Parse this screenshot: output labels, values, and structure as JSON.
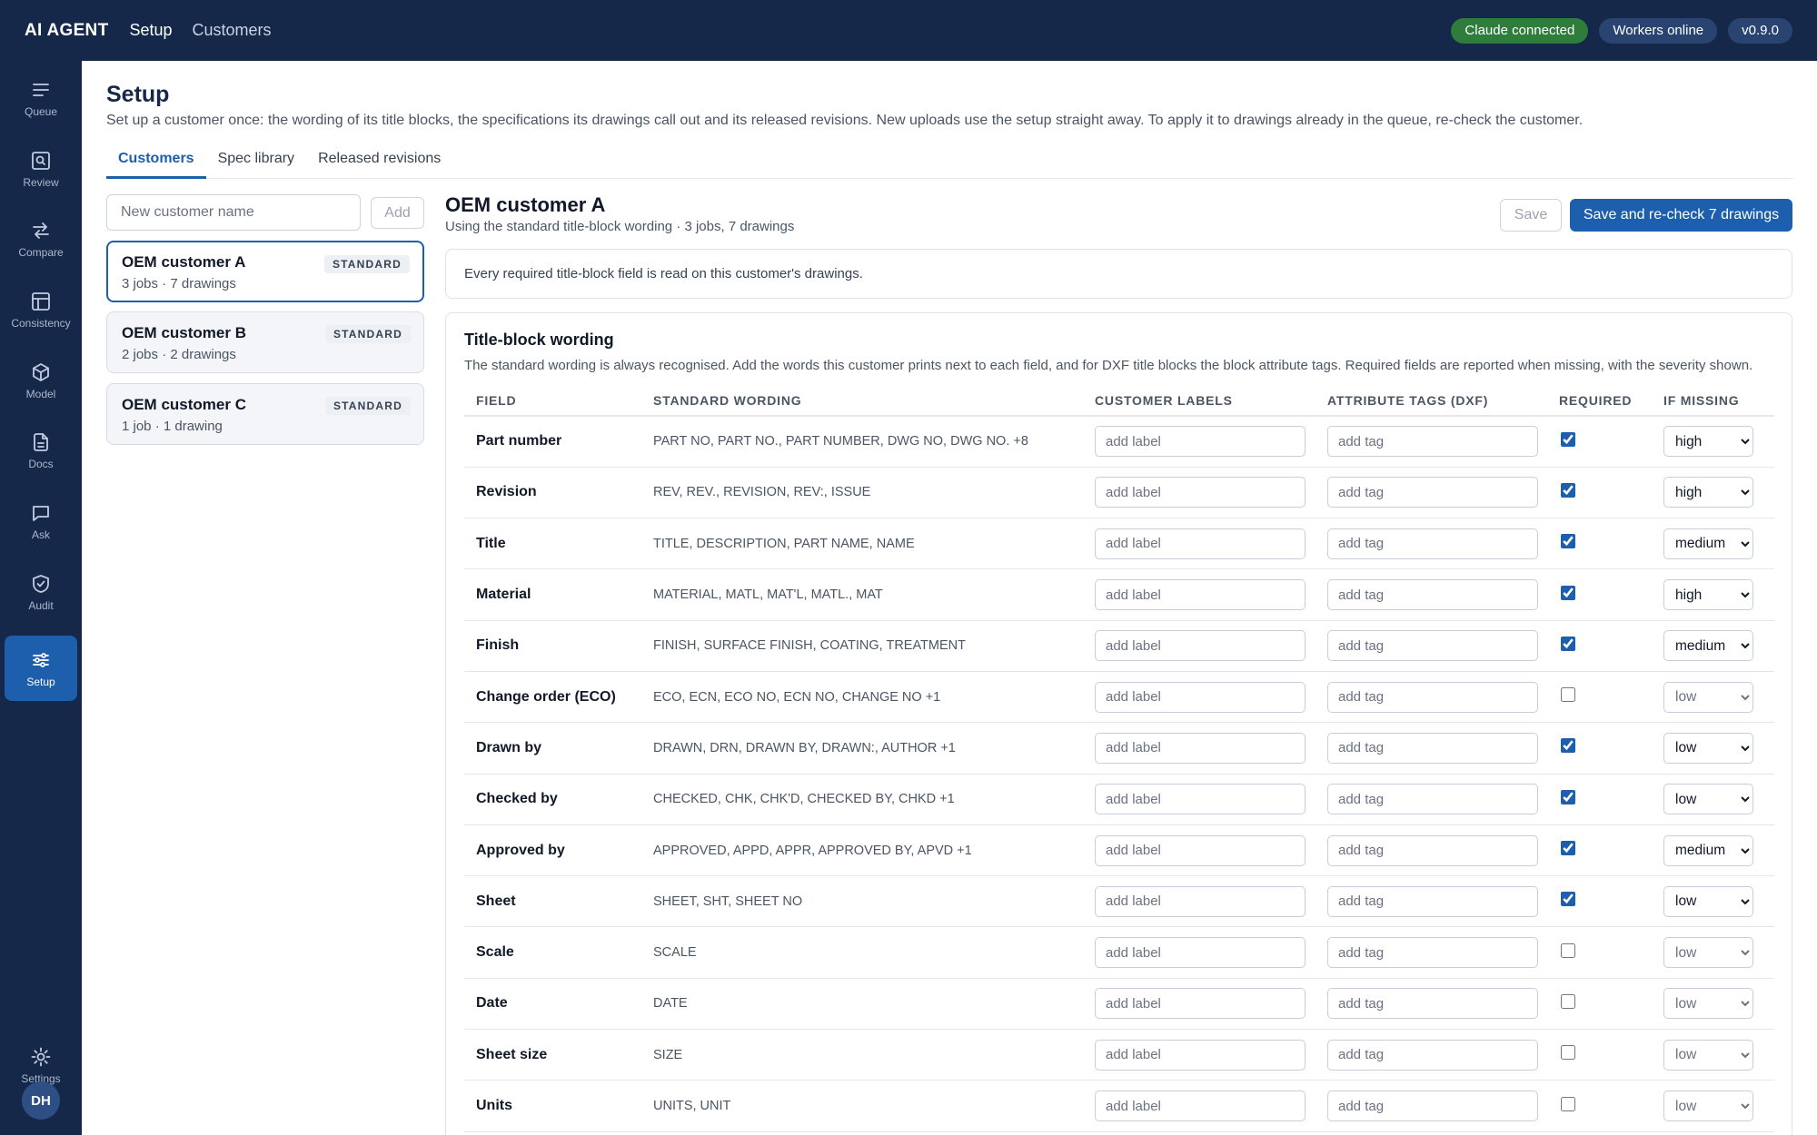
{
  "topbar": {
    "brand": "AI AGENT",
    "nav": [
      "Setup",
      "Customers"
    ],
    "status": [
      "Claude connected",
      "Workers online",
      "v0.9.0"
    ]
  },
  "sidebar": {
    "items": [
      {
        "label": "Queue",
        "icon": "queue-icon"
      },
      {
        "label": "Review",
        "icon": "review-icon"
      },
      {
        "label": "Compare",
        "icon": "compare-icon"
      },
      {
        "label": "Consistency",
        "icon": "consistency-icon"
      },
      {
        "label": "Model",
        "icon": "model-icon"
      },
      {
        "label": "Docs",
        "icon": "docs-icon"
      },
      {
        "label": "Ask",
        "icon": "ask-icon"
      },
      {
        "label": "Audit",
        "icon": "audit-icon"
      },
      {
        "label": "Setup",
        "icon": "setup-icon",
        "active": true
      }
    ],
    "settings_label": "Settings",
    "avatar": "DH"
  },
  "page": {
    "title": "Setup",
    "subtitle": "Set up a customer once: the wording of its title blocks, the specifications its drawings call out and its released revisions. New uploads use the setup straight away. To apply it to drawings already in the queue, re-check the customer.",
    "tabs": [
      "Customers",
      "Spec library",
      "Released revisions"
    ]
  },
  "customers": {
    "new_placeholder": "New customer name",
    "add_label": "Add",
    "list": [
      {
        "name": "OEM customer A",
        "meta": "3 jobs · 7 drawings",
        "badge": "STANDARD"
      },
      {
        "name": "OEM customer B",
        "meta": "2 jobs · 2 drawings",
        "badge": "STANDARD"
      },
      {
        "name": "OEM customer C",
        "meta": "1 job · 1 drawing",
        "badge": "STANDARD"
      }
    ]
  },
  "detail": {
    "title": "OEM customer A",
    "subtitle": "Using the standard title-block wording · 3 jobs, 7 drawings",
    "save_label": "Save",
    "recheck_label": "Save and re-check 7 drawings",
    "notice": "Every required title-block field is read on this customer's drawings."
  },
  "wording": {
    "title": "Title-block wording",
    "description": "The standard wording is always recognised. Add the words this customer prints next to each field, and for DXF title blocks the block attribute tags. Required fields are reported when missing, with the severity shown.",
    "columns": [
      "FIELD",
      "STANDARD WORDING",
      "CUSTOMER LABELS",
      "ATTRIBUTE TAGS (DXF)",
      "REQUIRED",
      "IF MISSING"
    ],
    "label_placeholder": "add label",
    "tag_placeholder": "add tag",
    "severity_options": [
      "high",
      "medium",
      "low"
    ],
    "rows": [
      {
        "field": "Part number",
        "standard": "PART NO, PART NO., PART NUMBER, DWG NO, DWG NO. +8",
        "required": true,
        "severity": "high"
      },
      {
        "field": "Revision",
        "standard": "REV, REV., REVISION, REV:, ISSUE",
        "required": true,
        "severity": "high"
      },
      {
        "field": "Title",
        "standard": "TITLE, DESCRIPTION, PART NAME, NAME",
        "required": true,
        "severity": "medium"
      },
      {
        "field": "Material",
        "standard": "MATERIAL, MATL, MAT'L, MATL., MAT",
        "required": true,
        "severity": "high"
      },
      {
        "field": "Finish",
        "standard": "FINISH, SURFACE FINISH, COATING, TREATMENT",
        "required": true,
        "severity": "medium"
      },
      {
        "field": "Change order (ECO)",
        "standard": "ECO, ECN, ECO NO, ECN NO, CHANGE NO +1",
        "required": false,
        "severity": "low"
      },
      {
        "field": "Drawn by",
        "standard": "DRAWN, DRN, DRAWN BY, DRAWN:, AUTHOR +1",
        "required": true,
        "severity": "low"
      },
      {
        "field": "Checked by",
        "standard": "CHECKED, CHK, CHK'D, CHECKED BY, CHKD +1",
        "required": true,
        "severity": "low"
      },
      {
        "field": "Approved by",
        "standard": "APPROVED, APPD, APPR, APPROVED BY, APVD +1",
        "required": true,
        "severity": "medium"
      },
      {
        "field": "Sheet",
        "standard": "SHEET, SHT, SHEET NO",
        "required": true,
        "severity": "low"
      },
      {
        "field": "Scale",
        "standard": "SCALE",
        "required": false,
        "severity": "low"
      },
      {
        "field": "Date",
        "standard": "DATE",
        "required": false,
        "severity": "low"
      },
      {
        "field": "Sheet size",
        "standard": "SIZE",
        "required": false,
        "severity": "low"
      },
      {
        "field": "Units",
        "standard": "UNITS, UNIT",
        "required": false,
        "severity": "low"
      }
    ]
  }
}
